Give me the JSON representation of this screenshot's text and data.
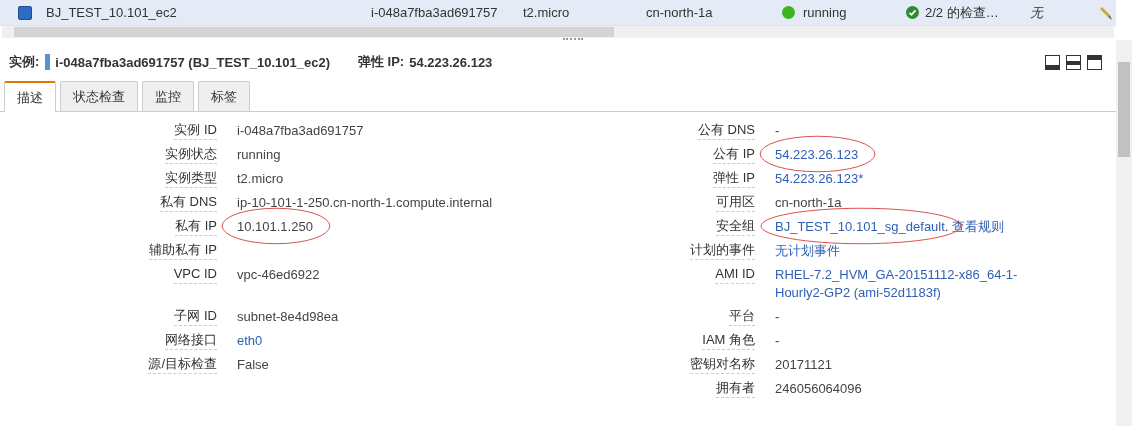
{
  "instance_row": {
    "selected": true,
    "name": "BJ_TEST_10.101_ec2",
    "instance_id": "i-048a7fba3ad691757",
    "type": "t2.micro",
    "zone": "cn-north-1a",
    "state": "running",
    "checks": "2/2 的检查…",
    "alarm": "无"
  },
  "header": {
    "instance_label": "实例:",
    "instance": "i-048a7fba3ad691757 (BJ_TEST_10.101_ec2)",
    "eip_label": "弹性 IP:",
    "eip": "54.223.26.123"
  },
  "tabs": [
    {
      "label": "描述",
      "selected": true
    },
    {
      "label": "状态检查",
      "selected": false
    },
    {
      "label": "监控",
      "selected": false
    },
    {
      "label": "标签",
      "selected": false
    }
  ],
  "details": [
    {
      "left": {
        "label": "实例 ID",
        "value": "i-048a7fba3ad691757",
        "link": false
      },
      "right": {
        "label": "公有 DNS",
        "value": "-",
        "link": false
      }
    },
    {
      "left": {
        "label": "实例状态",
        "value": "running",
        "link": false
      },
      "right": {
        "label": "公有 IP",
        "value": "54.223.26.123",
        "link": true,
        "circled": true
      }
    },
    {
      "left": {
        "label": "实例类型",
        "value": "t2.micro",
        "link": false
      },
      "right": {
        "label": "弹性 IP",
        "value": "54.223.26.123*",
        "link": true
      }
    },
    {
      "left": {
        "label": "私有 DNS",
        "value": "ip-10-101-1-250.cn-north-1.compute.internal",
        "link": false
      },
      "right": {
        "label": "可用区",
        "value": "cn-north-1a",
        "link": false
      }
    },
    {
      "left": {
        "label": "私有 IP",
        "value": "10.101.1.250",
        "link": false,
        "circled": true
      },
      "right": {
        "label": "安全组",
        "value": "BJ_TEST_10.101_sg_default",
        "link": true,
        "circled": true,
        "separator": ".",
        "extra_link": "查看规则"
      }
    },
    {
      "left": {
        "label": "辅助私有 IP"
      },
      "right": {
        "label": "计划的事件",
        "value": "无计划事件",
        "link": true
      }
    },
    {
      "left": {
        "label": "VPC ID",
        "value": "vpc-46ed6922",
        "link": false
      },
      "right": {
        "label": "AMI ID",
        "value": "RHEL-7.2_HVM_GA-20151112-x86_64-1-Hourly2-GP2 (ami-52d1183f)",
        "link": true
      }
    },
    {
      "left": {
        "label": "子网 ID",
        "value": "subnet-8e4d98ea",
        "link": false
      },
      "right": {
        "label": "平台",
        "value": "-",
        "link": false
      }
    },
    {
      "left": {
        "label": "网络接口",
        "value": "eth0",
        "link": true
      },
      "right": {
        "label": "IAM 角色",
        "value": "-",
        "link": false
      }
    },
    {
      "left": {
        "label": "源/目标检查",
        "value": "False",
        "link": false
      },
      "right": {
        "label": "密钥对名称",
        "value": "20171121",
        "link": false
      }
    },
    {
      "right": {
        "label": "拥有者",
        "value": "246056064096",
        "link": false
      }
    }
  ]
}
